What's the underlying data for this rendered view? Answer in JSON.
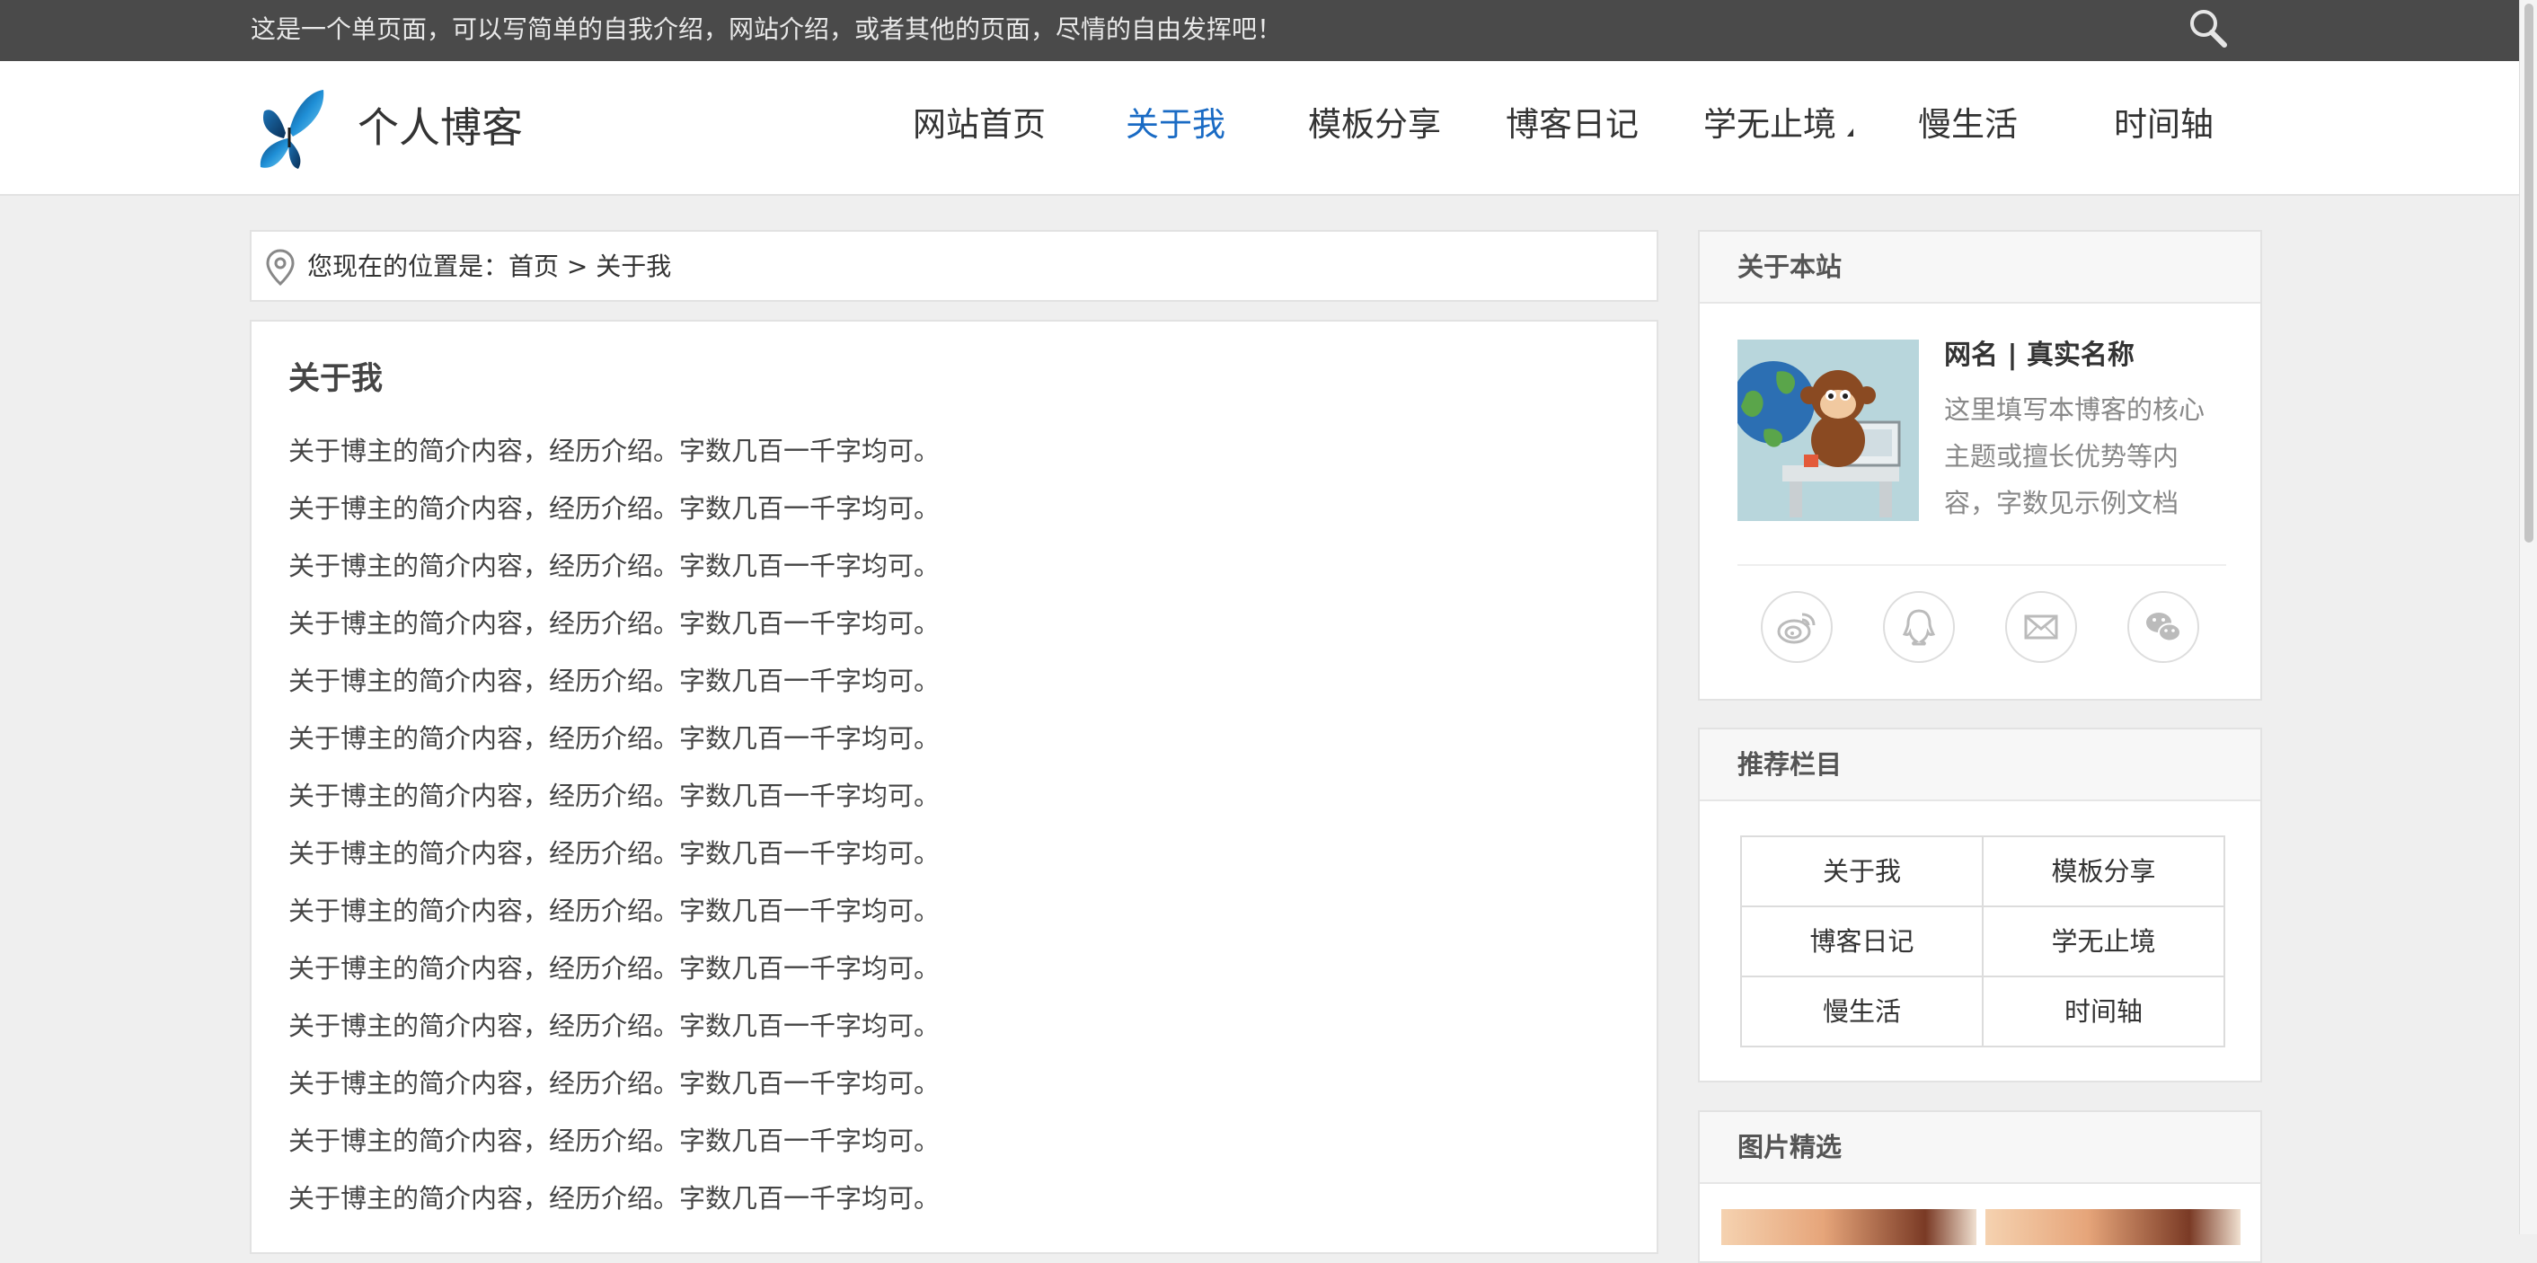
{
  "topbar": {
    "notice": "这是一个单页面，可以写简单的自我介绍，网站介绍，或者其他的页面，尽情的自由发挥吧！",
    "search_icon": "search-icon"
  },
  "header": {
    "logo_text": "个人博客",
    "logo_icon": "butterfly-logo",
    "nav": [
      {
        "label": "网站首页",
        "active": false
      },
      {
        "label": "关于我",
        "active": true
      },
      {
        "label": "模板分享",
        "active": false
      },
      {
        "label": "博客日记",
        "active": false
      },
      {
        "label": "学无止境",
        "active": false,
        "has_submenu": true
      },
      {
        "label": "慢生活",
        "active": false
      },
      {
        "label": "时间轴",
        "active": false
      }
    ],
    "active_color": "#1a6bc4"
  },
  "breadcrumb": {
    "prefix": "您现在的位置是：",
    "home": "首页",
    "separator": " > ",
    "current": "关于我"
  },
  "article": {
    "title": "关于我",
    "paragraphs": [
      "关于博主的简介内容，经历介绍。字数几百一千字均可。",
      "关于博主的简介内容，经历介绍。字数几百一千字均可。",
      "关于博主的简介内容，经历介绍。字数几百一千字均可。",
      "关于博主的简介内容，经历介绍。字数几百一千字均可。",
      "关于博主的简介内容，经历介绍。字数几百一千字均可。",
      "关于博主的简介内容，经历介绍。字数几百一千字均可。",
      "关于博主的简介内容，经历介绍。字数几百一千字均可。",
      "关于博主的简介内容，经历介绍。字数几百一千字均可。",
      "关于博主的简介内容，经历介绍。字数几百一千字均可。",
      "关于博主的简介内容，经历介绍。字数几百一千字均可。",
      "关于博主的简介内容，经历介绍。字数几百一千字均可。",
      "关于博主的简介内容，经历介绍。字数几百一千字均可。",
      "关于博主的简介内容，经历介绍。字数几百一千字均可。",
      "关于博主的简介内容，经历介绍。字数几百一千字均可。"
    ]
  },
  "sidebar": {
    "about": {
      "title": "关于本站",
      "name": "网名 | 真实名称",
      "description": "这里填写本博客的核心主题或擅长优势等内容，字数见示例文档",
      "social": [
        "weibo-icon",
        "qq-icon",
        "mail-icon",
        "wechat-icon"
      ]
    },
    "recommend": {
      "title": "推荐栏目",
      "items": [
        "关于我",
        "模板分享",
        "博客日记",
        "学无止境",
        "慢生活",
        "时间轴"
      ]
    },
    "gallery": {
      "title": "图片精选"
    }
  }
}
